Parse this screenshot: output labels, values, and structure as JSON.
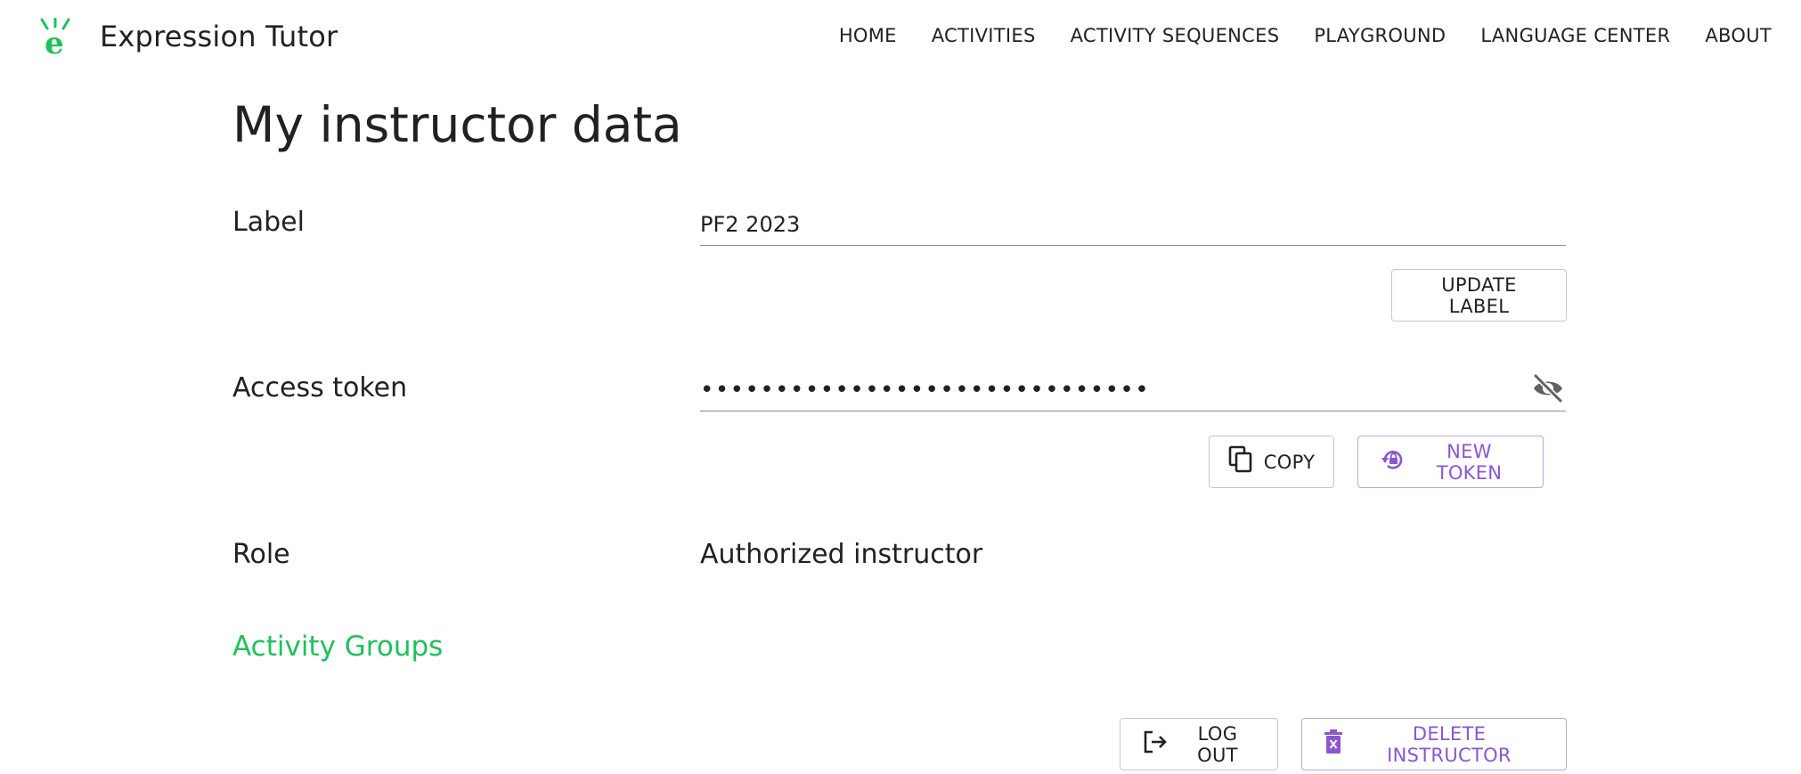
{
  "app": {
    "title": "Expression Tutor",
    "brand_color": "#1fc15c",
    "accent_purple": "#8a56d1"
  },
  "nav": {
    "items": [
      {
        "label": "HOME"
      },
      {
        "label": "ACTIVITIES"
      },
      {
        "label": "ACTIVITY SEQUENCES"
      },
      {
        "label": "PLAYGROUND"
      },
      {
        "label": "LANGUAGE CENTER"
      },
      {
        "label": "ABOUT"
      }
    ]
  },
  "page": {
    "title": "My instructor data"
  },
  "label_section": {
    "label": "Label",
    "value": "PF2 2023",
    "update_button": "UPDATE LABEL"
  },
  "token_section": {
    "label": "Access token",
    "masked_value": "••••••••••••••••••••••••••••••",
    "visibility_icon": "eye-off-icon",
    "copy_button": "COPY",
    "new_token_button": "NEW TOKEN"
  },
  "role_section": {
    "label": "Role",
    "value": "Authorized instructor"
  },
  "groups": {
    "link": "Activity Groups"
  },
  "actions": {
    "logout_button": "LOG OUT",
    "delete_button": "DELETE INSTRUCTOR"
  }
}
